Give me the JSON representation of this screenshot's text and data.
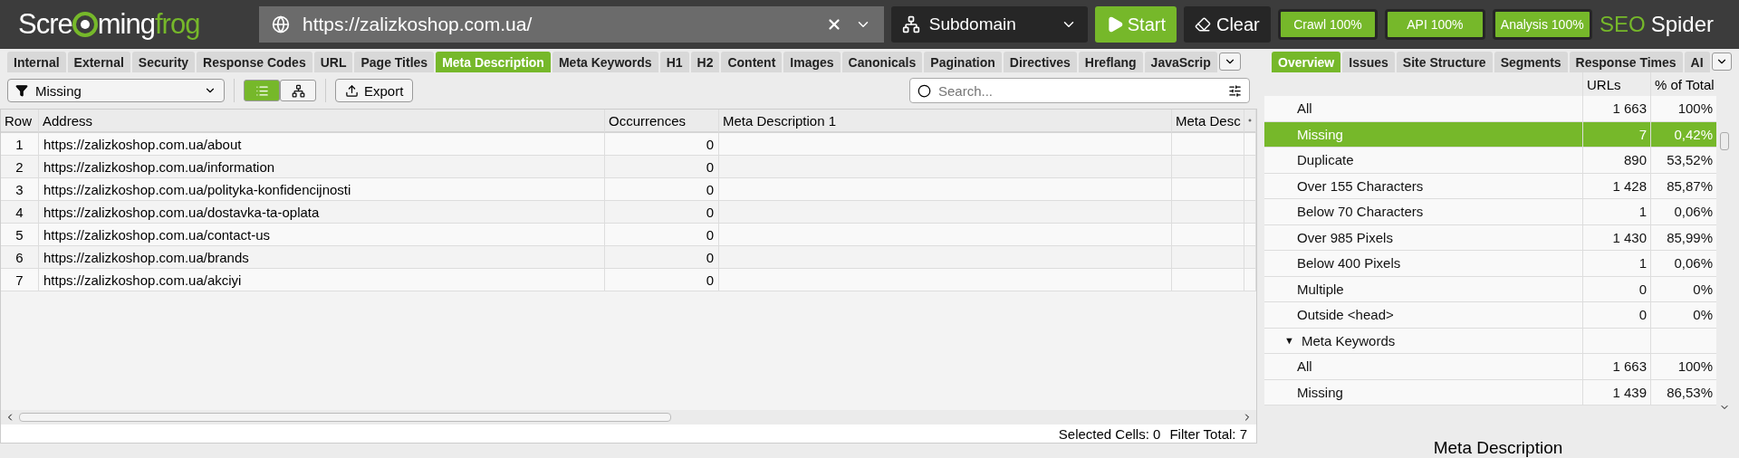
{
  "logo": {
    "parts": [
      "Scre",
      "ming",
      "frog"
    ]
  },
  "url_bar": {
    "value": "https://zalizkoshop.com.ua/"
  },
  "mode_dropdown": {
    "value": "Subdomain"
  },
  "buttons": {
    "start": "Start",
    "clear": "Clear"
  },
  "progress": [
    {
      "label": "Crawl 100%"
    },
    {
      "label": "API 100%"
    },
    {
      "label": "Analysis 100%"
    }
  ],
  "product": {
    "brand": "SEO",
    "name": "Spider"
  },
  "tabs": [
    {
      "label": "Internal",
      "selected": false
    },
    {
      "label": "External",
      "selected": false
    },
    {
      "label": "Security",
      "selected": false
    },
    {
      "label": "Response Codes",
      "selected": false
    },
    {
      "label": "URL",
      "selected": false
    },
    {
      "label": "Page Titles",
      "selected": false
    },
    {
      "label": "Meta Description",
      "selected": true
    },
    {
      "label": "Meta Keywords",
      "selected": false
    },
    {
      "label": "H1",
      "selected": false
    },
    {
      "label": "H2",
      "selected": false
    },
    {
      "label": "Content",
      "selected": false
    },
    {
      "label": "Images",
      "selected": false
    },
    {
      "label": "Canonicals",
      "selected": false
    },
    {
      "label": "Pagination",
      "selected": false
    },
    {
      "label": "Directives",
      "selected": false
    },
    {
      "label": "Hreflang",
      "selected": false
    },
    {
      "label": "JavaScrip",
      "selected": false
    }
  ],
  "filter": {
    "value": "Missing"
  },
  "view_toggle": [
    {
      "kind": "list",
      "selected": true
    },
    {
      "kind": "tree",
      "selected": false
    }
  ],
  "export": "Export",
  "search": {
    "placeholder": "Search..."
  },
  "table": {
    "columns": [
      "Row",
      "Address",
      "Occurrences",
      "Meta Description 1",
      "Meta Desc"
    ],
    "rows": [
      [
        "1",
        "https://zalizkoshop.com.ua/about",
        "0",
        "",
        ""
      ],
      [
        "2",
        "https://zalizkoshop.com.ua/information",
        "0",
        "",
        ""
      ],
      [
        "3",
        "https://zalizkoshop.com.ua/polityka-konfidencijnosti",
        "0",
        "",
        ""
      ],
      [
        "4",
        "https://zalizkoshop.com.ua/dostavka-ta-oplata",
        "0",
        "",
        ""
      ],
      [
        "5",
        "https://zalizkoshop.com.ua/contact-us",
        "0",
        "",
        ""
      ],
      [
        "6",
        "https://zalizkoshop.com.ua/brands",
        "0",
        "",
        ""
      ],
      [
        "7",
        "https://zalizkoshop.com.ua/akciyi",
        "0",
        "",
        ""
      ]
    ]
  },
  "status_bar": {
    "selected_cells_label": "Selected Cells:",
    "selected_cells": "0",
    "filter_total_label": "Filter Total:",
    "filter_total": "7"
  },
  "right_tabs": [
    {
      "label": "Overview",
      "selected": true
    },
    {
      "label": "Issues",
      "selected": false
    },
    {
      "label": "Site Structure",
      "selected": false
    },
    {
      "label": "Segments",
      "selected": false
    },
    {
      "label": "Response Times",
      "selected": false
    },
    {
      "label": "AI",
      "selected": false
    }
  ],
  "overview": {
    "columns": [
      "URLs",
      "% of Total"
    ],
    "rows": [
      {
        "kind": "item",
        "label": "All",
        "urls": "1 663",
        "percent": "100%",
        "selected": false
      },
      {
        "kind": "item",
        "label": "Missing",
        "urls": "7",
        "percent": "0,42%",
        "selected": true
      },
      {
        "kind": "item",
        "label": "Duplicate",
        "urls": "890",
        "percent": "53,52%",
        "selected": false
      },
      {
        "kind": "item",
        "label": "Over 155 Characters",
        "urls": "1 428",
        "percent": "85,87%",
        "selected": false
      },
      {
        "kind": "item",
        "label": "Below 70 Characters",
        "urls": "1",
        "percent": "0,06%",
        "selected": false
      },
      {
        "kind": "item",
        "label": "Over 985 Pixels",
        "urls": "1 430",
        "percent": "85,99%",
        "selected": false
      },
      {
        "kind": "item",
        "label": "Below 400 Pixels",
        "urls": "1",
        "percent": "0,06%",
        "selected": false
      },
      {
        "kind": "item",
        "label": "Multiple",
        "urls": "0",
        "percent": "0%",
        "selected": false
      },
      {
        "kind": "item",
        "label": "Outside <head>",
        "urls": "0",
        "percent": "0%",
        "selected": false
      },
      {
        "kind": "group",
        "toggle": "▼",
        "label": "Meta Keywords",
        "selected": false
      },
      {
        "kind": "item",
        "label": "All",
        "urls": "1 663",
        "percent": "100%",
        "selected": false
      },
      {
        "kind": "item",
        "label": "Missing",
        "urls": "1 439",
        "percent": "86,53%",
        "selected": false
      }
    ]
  },
  "chart_title": "Meta Description"
}
